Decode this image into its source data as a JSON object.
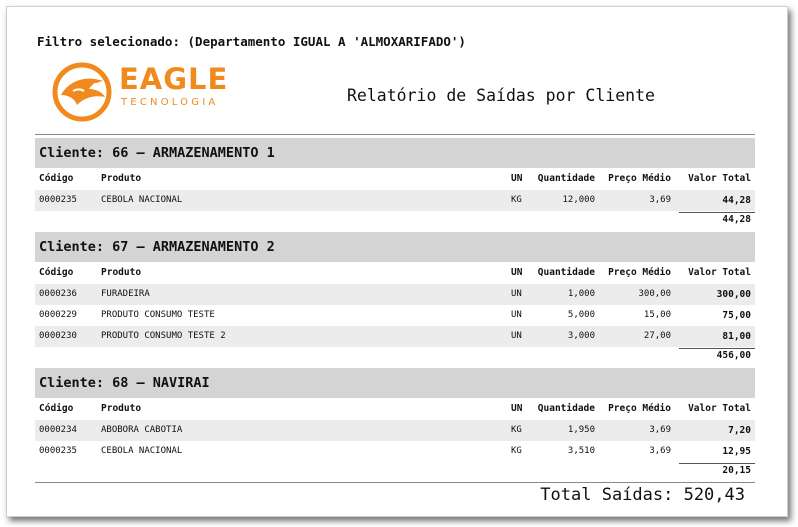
{
  "filter_text": "Filtro selecionado: (Departamento IGUAL A 'ALMOXARIFADO')",
  "logo": {
    "word": "EAGLE",
    "sub": "TECNOLOGIA",
    "color": "#f08a1c"
  },
  "report_title": "Relatório de Saídas por Cliente",
  "columns": {
    "codigo": "Código",
    "produto": "Produto",
    "un": "UN",
    "quantidade": "Quantidade",
    "preco_medio": "Preço Médio",
    "valor_total": "Valor Total"
  },
  "groups": [
    {
      "header": "Cliente: 66 – ARMAZENAMENTO 1",
      "rows": [
        {
          "codigo": "0000235",
          "produto": "CEBOLA NACIONAL",
          "un": "KG",
          "quantidade": "12,000",
          "preco_medio": "3,69",
          "valor_total": "44,28"
        }
      ],
      "subtotal": "44,28"
    },
    {
      "header": "Cliente: 67 – ARMAZENAMENTO 2",
      "rows": [
        {
          "codigo": "0000236",
          "produto": "FURADEIRA",
          "un": "UN",
          "quantidade": "1,000",
          "preco_medio": "300,00",
          "valor_total": "300,00"
        },
        {
          "codigo": "0000229",
          "produto": "PRODUTO CONSUMO TESTE",
          "un": "UN",
          "quantidade": "5,000",
          "preco_medio": "15,00",
          "valor_total": "75,00"
        },
        {
          "codigo": "0000230",
          "produto": "PRODUTO CONSUMO TESTE 2",
          "un": "UN",
          "quantidade": "3,000",
          "preco_medio": "27,00",
          "valor_total": "81,00"
        }
      ],
      "subtotal": "456,00"
    },
    {
      "header": "Cliente: 68 – NAVIRAI",
      "rows": [
        {
          "codigo": "0000234",
          "produto": "ABOBORA CABOTIA",
          "un": "KG",
          "quantidade": "1,950",
          "preco_medio": "3,69",
          "valor_total": "7,20"
        },
        {
          "codigo": "0000235",
          "produto": "CEBOLA NACIONAL",
          "un": "KG",
          "quantidade": "3,510",
          "preco_medio": "3,69",
          "valor_total": "12,95"
        }
      ],
      "subtotal": "20,15"
    }
  ],
  "grand_total": "Total Saídas: 520,43"
}
